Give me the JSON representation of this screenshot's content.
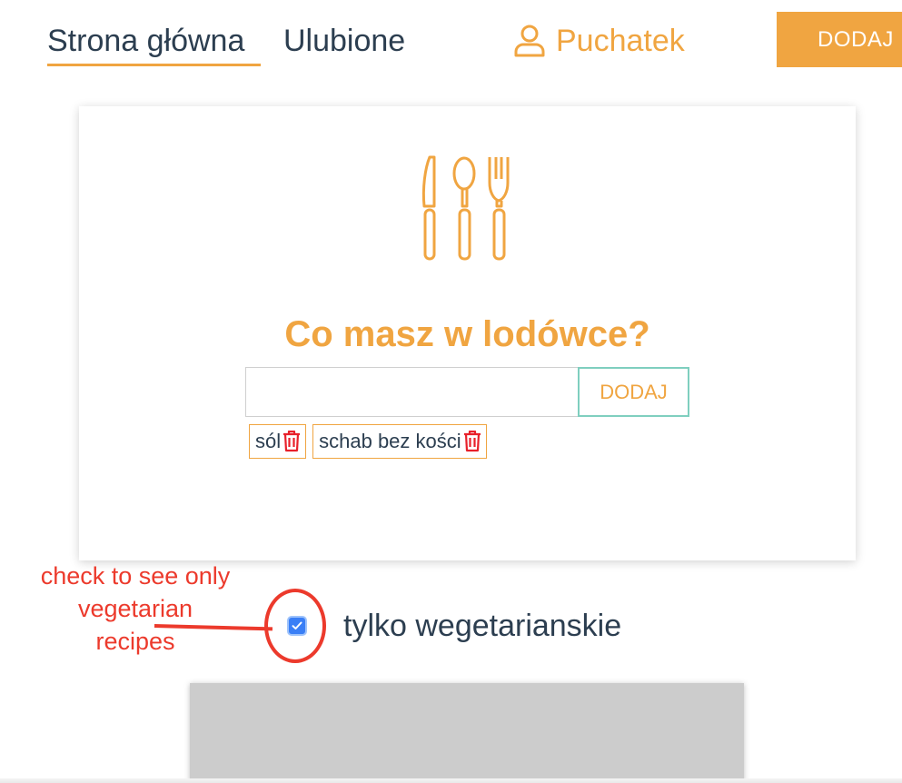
{
  "nav": {
    "home_label": "Strona główna",
    "favorites_label": "Ulubione",
    "user_name": "Puchatek",
    "add_button_label": "DODAJ"
  },
  "card": {
    "title": "Co masz w lodówce?",
    "input_value": "",
    "add_button_label": "DODAJ",
    "tags": [
      "sól",
      "schab bez kości"
    ]
  },
  "filter": {
    "label": "tylko wegetarianskie",
    "checked": true
  },
  "annotation": {
    "text": "check to see only vegetarian recipes"
  },
  "colors": {
    "accent": "#f0a541",
    "text": "#2c3e50",
    "delete": "#e8202a",
    "annotation": "#ec3a2c",
    "checkbox": "#3a7ff6"
  },
  "icons": {
    "user": "user-icon",
    "cutlery": "cutlery-icon",
    "delete": "trash-icon",
    "check": "check-icon"
  }
}
